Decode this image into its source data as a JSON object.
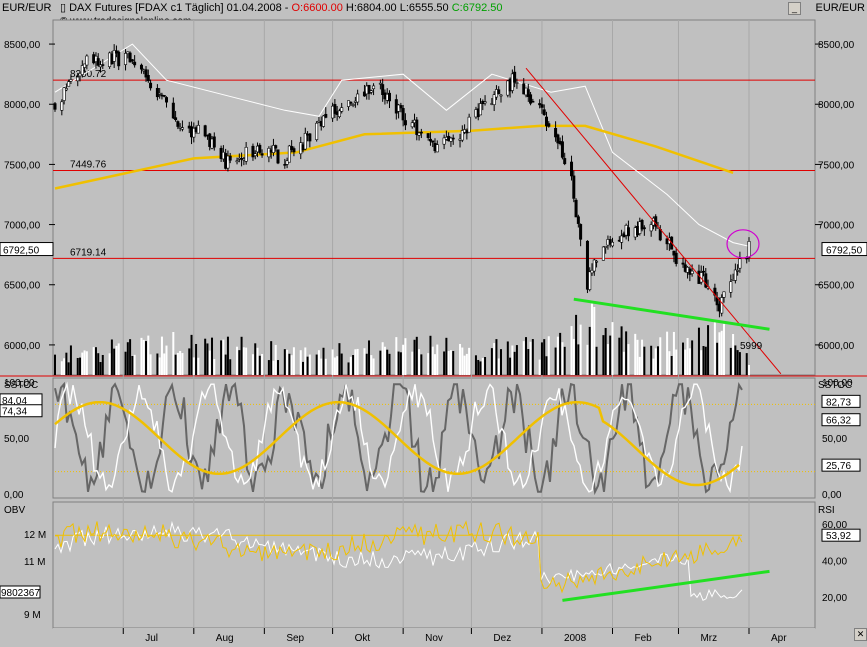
{
  "window": {
    "currency_left": "EUR/EUR",
    "currency_right": "EUR/EUR",
    "header": {
      "symbol": "DAX Futures [FDAX c1  Täglich] 01.04.2008 -",
      "open": "O:6600.00",
      "high_low": "H:6804.00 L:6555.50",
      "close": "C:6792.50"
    },
    "copyright": "© www.tradesignalonline.com"
  },
  "panels": {
    "price": {
      "y_ticks": [
        "8500,00",
        "8000,00",
        "7500,00",
        "7000,00",
        "6500,00",
        "6000,00"
      ],
      "current_badge": "6792,50",
      "levels": [
        {
          "value": 8200.72,
          "label": "8200.72"
        },
        {
          "value": 7449.76,
          "label": "7449.76"
        },
        {
          "value": 6719.14,
          "label": "6719.14"
        }
      ],
      "trend_label": "5999"
    },
    "sstoc": {
      "title_left": "SSTOC",
      "title_right": "SSTOC",
      "y_ticks": [
        "100,00",
        "50,00",
        "0,00"
      ],
      "left_badges": [
        "84,04",
        "74,34"
      ],
      "right_badges": [
        "82,73",
        "66,32",
        "25,76"
      ]
    },
    "obv": {
      "title_left": "OBV",
      "title_right": "RSI",
      "left_ticks": [
        "12 M",
        "11 M",
        "9 M"
      ],
      "left_badge": "9802367",
      "right_ticks": [
        "60,00",
        "40,00",
        "20,00"
      ],
      "right_badge": "53,92"
    },
    "x_axis": [
      "Jul",
      "Aug",
      "Sep",
      "Okt",
      "Nov",
      "Dez",
      "2008",
      "Feb",
      "Mrz",
      "Apr"
    ]
  },
  "colors": {
    "background": "#c0c0c0",
    "level_line": "#e00000",
    "moving_average": "#f0c000",
    "envelope": "#ffffff",
    "volume": "#000000",
    "trend_green": "#22e022",
    "circle": "#d000d0"
  },
  "chart_data": [
    {
      "type": "candlestick",
      "title": "DAX Futures [FDAX c1 Täglich] 01.04.2008",
      "ylim": [
        5750,
        8700
      ],
      "x_range": [
        "2007-06-01",
        "2008-04-30"
      ],
      "x_ticks": [
        "Jul",
        "Aug",
        "Sep",
        "Okt",
        "Nov",
        "Dez",
        "2008",
        "Feb",
        "Mrz",
        "Apr"
      ],
      "price_path": [
        [
          "2007-06-01",
          8000
        ],
        [
          "2007-06-15",
          8350
        ],
        [
          "2007-07-05",
          8400
        ],
        [
          "2007-07-15",
          8150
        ],
        [
          "2007-07-25",
          7850
        ],
        [
          "2007-08-05",
          7750
        ],
        [
          "2007-08-16",
          7500
        ],
        [
          "2007-08-30",
          7650
        ],
        [
          "2007-09-10",
          7550
        ],
        [
          "2007-09-25",
          7800
        ],
        [
          "2007-10-05",
          8000
        ],
        [
          "2007-10-20",
          8150
        ],
        [
          "2007-11-01",
          7900
        ],
        [
          "2007-11-15",
          7650
        ],
        [
          "2007-11-28",
          7800
        ],
        [
          "2007-12-10",
          8050
        ],
        [
          "2007-12-20",
          8200
        ],
        [
          "2007-12-28",
          8050
        ],
        [
          "2008-01-08",
          7700
        ],
        [
          "2008-01-14",
          7350
        ],
        [
          "2008-01-21",
          6500
        ],
        [
          "2008-01-28",
          6850
        ],
        [
          "2008-02-08",
          6950
        ],
        [
          "2008-02-20",
          7000
        ],
        [
          "2008-03-03",
          6650
        ],
        [
          "2008-03-12",
          6550
        ],
        [
          "2008-03-19",
          6350
        ],
        [
          "2008-03-26",
          6650
        ],
        [
          "2008-04-01",
          6792.5
        ]
      ],
      "volume_path": [
        [
          "2007-06-01",
          0.35
        ],
        [
          "2007-07-01",
          0.5
        ],
        [
          "2007-08-01",
          0.6
        ],
        [
          "2007-09-01",
          0.45
        ],
        [
          "2007-10-01",
          0.4
        ],
        [
          "2007-11-01",
          0.55
        ],
        [
          "2007-12-01",
          0.45
        ],
        [
          "2008-01-10",
          0.55
        ],
        [
          "2008-01-21",
          1.0
        ],
        [
          "2008-02-10",
          0.55
        ],
        [
          "2008-03-01",
          0.6
        ],
        [
          "2008-03-20",
          0.8
        ],
        [
          "2008-04-01",
          0.35
        ]
      ],
      "moving_average": [
        [
          "2007-06-01",
          7300
        ],
        [
          "2007-08-01",
          7550
        ],
        [
          "2007-09-15",
          7600
        ],
        [
          "2007-10-15",
          7750
        ],
        [
          "2007-12-01",
          7780
        ],
        [
          "2007-12-31",
          7820
        ],
        [
          "2008-01-20",
          7820
        ],
        [
          "2008-02-20",
          7650
        ],
        [
          "2008-03-25",
          7430
        ]
      ],
      "envelope": [
        [
          "2007-06-01",
          8100
        ],
        [
          "2007-07-05",
          8500
        ],
        [
          "2007-07-20",
          8200
        ],
        [
          "2007-08-20",
          8050
        ],
        [
          "2007-09-10",
          7950
        ],
        [
          "2007-09-25",
          7900
        ],
        [
          "2007-10-05",
          8200
        ],
        [
          "2007-11-01",
          8250
        ],
        [
          "2007-11-20",
          7950
        ],
        [
          "2007-12-10",
          8250
        ],
        [
          "2008-01-05",
          8100
        ],
        [
          "2008-01-20",
          8150
        ],
        [
          "2008-02-01",
          7600
        ],
        [
          "2008-02-25",
          7250
        ],
        [
          "2008-03-10",
          7000
        ],
        [
          "2008-03-25",
          6850
        ],
        [
          "2008-04-01",
          6820
        ]
      ],
      "horizontal_levels": [
        8200.72,
        7449.76,
        6719.14
      ],
      "trendline": [
        [
          "2007-12-25",
          8300
        ],
        [
          "2008-04-15",
          5760
        ]
      ],
      "trendline_label": "5999",
      "support_line": [
        [
          "2008-01-15",
          6380
        ],
        [
          "2008-04-10",
          6130
        ]
      ],
      "last_value": 6792.5
    },
    {
      "type": "line",
      "title": "SSTOC",
      "ylim": [
        0,
        100
      ],
      "x_range": [
        "2007-06-01",
        "2008-04-30"
      ],
      "series": [
        {
          "name": "",
          "values": [
            84.04,
            74.34
          ],
          "last": 82.73
        },
        {
          "name": "",
          "values": [
            66.32
          ],
          "last": 66.32
        },
        {
          "name": "",
          "values": [
            25.76
          ],
          "last": 25.76
        }
      ],
      "reference_levels": [
        80,
        20
      ]
    },
    {
      "type": "line",
      "title": "OBV / RSI",
      "left_axis": {
        "label": "OBV",
        "ticks": [
          "12 M",
          "11 M",
          "9 M"
        ],
        "last": 9802367
      },
      "right_axis": {
        "label": "RSI",
        "ticks": [
          60,
          40,
          20
        ],
        "last": 53.92
      },
      "x_range": [
        "2007-06-01",
        "2008-04-30"
      ],
      "rsi_reference": 53.92,
      "support_line": [
        [
          "2008-01-10",
          18
        ],
        [
          "2008-04-10",
          34
        ]
      ]
    }
  ]
}
